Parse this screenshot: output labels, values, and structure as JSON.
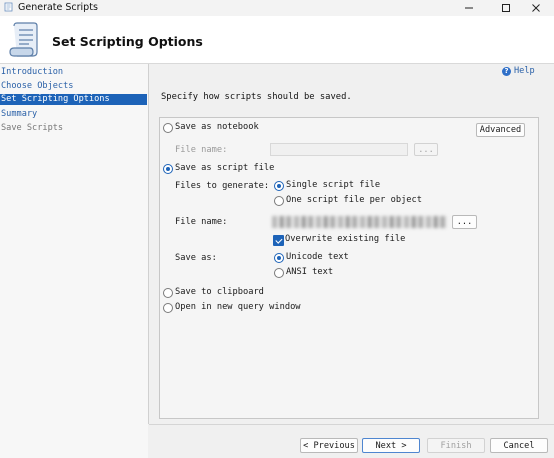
{
  "window": {
    "title": "Generate Scripts",
    "minimize_icon": "minimize-icon",
    "maximize_icon": "maximize-icon",
    "close_icon": "close-icon"
  },
  "header": {
    "title": "Set Scripting Options",
    "icon": "scroll-icon"
  },
  "nav": {
    "items": [
      {
        "label": "Introduction",
        "state": "link"
      },
      {
        "label": "Choose Objects",
        "state": "link"
      },
      {
        "label": "Set Scripting Options",
        "state": "selected"
      },
      {
        "label": "Summary",
        "state": "link"
      },
      {
        "label": "Save Scripts",
        "state": "disabled"
      }
    ]
  },
  "help": {
    "label": "Help",
    "icon": "help-icon"
  },
  "instructions": "Specify how scripts should be saved.",
  "options": {
    "notebook": {
      "label": "Save as notebook",
      "selected": false
    },
    "advanced_button": "Advanced",
    "notebook_file_label": "File name:",
    "browse_label": "...",
    "script_file": {
      "label": "Save as script file",
      "selected": true
    },
    "files_to_generate_label": "Files to generate:",
    "single_file": {
      "label": "Single script file",
      "selected": true
    },
    "per_object": {
      "label": "One script file per object",
      "selected": false
    },
    "file_name_label": "File name:",
    "overwrite": {
      "label": "Overwrite existing file",
      "checked": true
    },
    "save_as_label": "Save as:",
    "unicode": {
      "label": "Unicode text",
      "selected": true
    },
    "ansi": {
      "label": "ANSI text",
      "selected": false
    },
    "clipboard": {
      "label": "Save to clipboard",
      "selected": false
    },
    "query_window": {
      "label": "Open in new query window",
      "selected": false
    }
  },
  "footer": {
    "previous": "< Previous",
    "next": "Next >",
    "finish": "Finish",
    "cancel": "Cancel"
  },
  "colors": {
    "accent": "#1d63b8",
    "link": "#2b61a8"
  }
}
